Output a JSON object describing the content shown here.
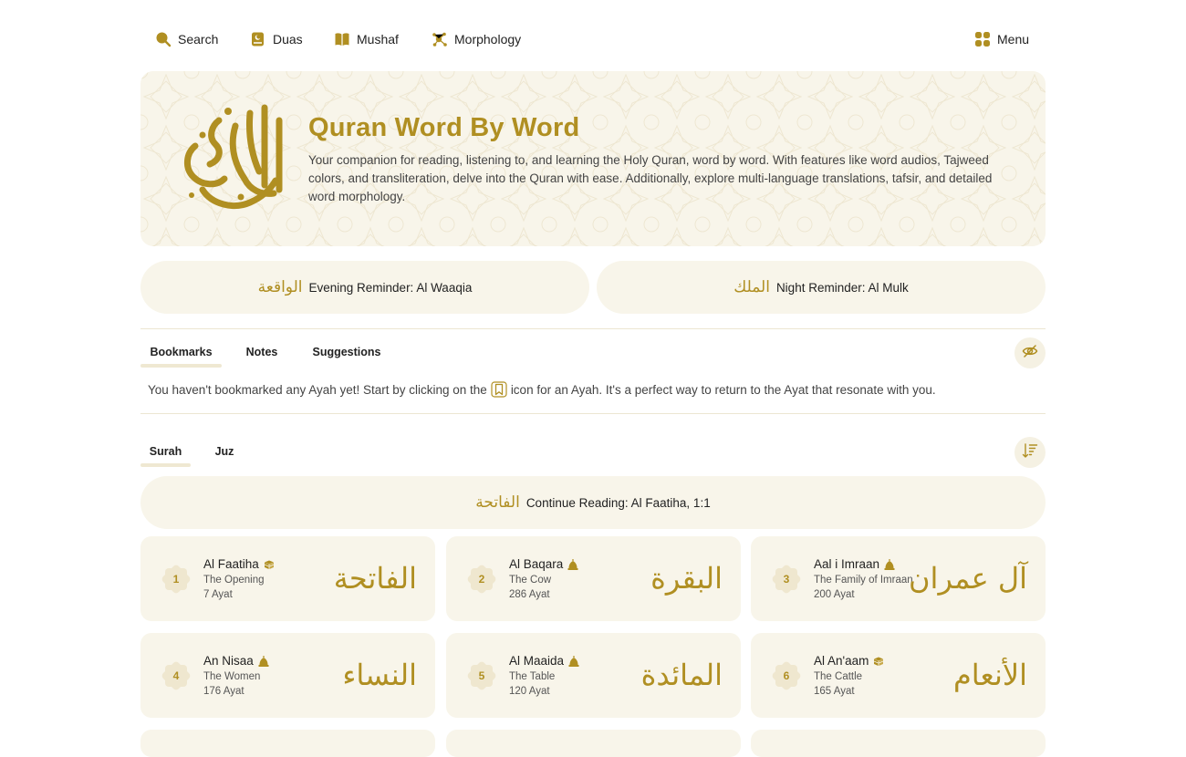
{
  "nav": {
    "items": [
      {
        "label": "Search",
        "icon": "search-icon"
      },
      {
        "label": "Duas",
        "icon": "duas-icon"
      },
      {
        "label": "Mushaf",
        "icon": "book-icon"
      },
      {
        "label": "Morphology",
        "icon": "morphology-icon"
      }
    ],
    "menu_label": "Menu",
    "menu_icon": "grid-icon"
  },
  "hero": {
    "title": "Quran Word By Word",
    "description": "Your companion for reading, listening to, and learning the Holy Quran, word by word. With features like word audios, Tajweed colors, and transliteration, delve into the Quran with ease. Additionally, explore multi-language translations, tafsir, and detailed word morphology.",
    "logo_calligraphy": "القرآن الكريم"
  },
  "reminders": [
    {
      "calligraphy": "الواقعة",
      "label": "Evening Reminder: Al Waaqia"
    },
    {
      "calligraphy": "الملك",
      "label": "Night Reminder: Al Mulk"
    }
  ],
  "saved_tabs": {
    "items": [
      "Bookmarks",
      "Notes",
      "Suggestions"
    ],
    "active": "Bookmarks",
    "toggle_icon": "eye-off-icon"
  },
  "bookmarks": {
    "empty_before": "You haven't bookmarked any Ayah yet! Start by clicking on the",
    "empty_after": "icon for an Ayah. It's a perfect way to return to the Ayat that resonate with you.",
    "inline_icon": "bookmark-icon"
  },
  "list_tabs": {
    "items": [
      "Surah",
      "Juz"
    ],
    "active": "Surah",
    "sort_icon": "sort-icon"
  },
  "continue": {
    "calligraphy": "الفاتحة",
    "label": "Continue Reading: Al Faatiha, 1:1"
  },
  "surahs": [
    {
      "number": "1",
      "name": "Al Faatiha",
      "meaning": "The Opening",
      "ayat": "7 Ayat",
      "revelation": "makkah-icon",
      "arabic": "الفاتحة"
    },
    {
      "number": "2",
      "name": "Al Baqara",
      "meaning": "The Cow",
      "ayat": "286 Ayat",
      "revelation": "madinah-icon",
      "arabic": "البقرة"
    },
    {
      "number": "3",
      "name": "Aal i Imraan",
      "meaning": "The Family of Imraan",
      "ayat": "200 Ayat",
      "revelation": "madinah-icon",
      "arabic": "آل عمران"
    },
    {
      "number": "4",
      "name": "An Nisaa",
      "meaning": "The Women",
      "ayat": "176 Ayat",
      "revelation": "madinah-icon",
      "arabic": "النساء"
    },
    {
      "number": "5",
      "name": "Al Maaida",
      "meaning": "The Table",
      "ayat": "120 Ayat",
      "revelation": "madinah-icon",
      "arabic": "المائدة"
    },
    {
      "number": "6",
      "name": "Al An'aam",
      "meaning": "The Cattle",
      "ayat": "165 Ayat",
      "revelation": "makkah-icon",
      "arabic": "الأنعام"
    }
  ],
  "colors": {
    "accent": "#b08f22",
    "card_bg": "#f8f5ea",
    "star_bg": "#efe7cf"
  }
}
